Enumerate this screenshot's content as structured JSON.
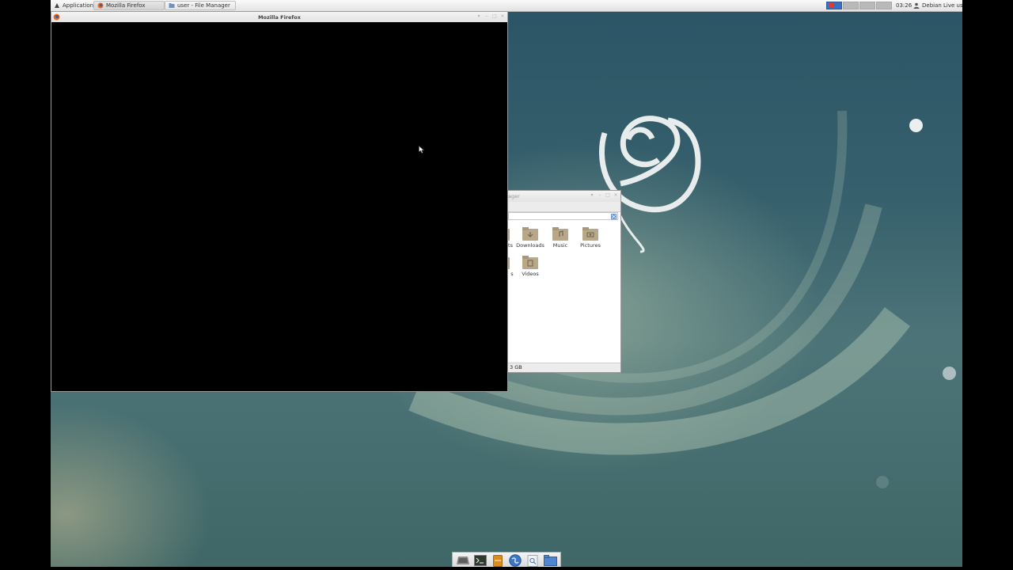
{
  "top_panel": {
    "applications_label": "Applications",
    "tasks": [
      {
        "label": "Mozilla Firefox",
        "icon": "firefox-icon"
      },
      {
        "label": "user - File Manager",
        "icon": "folder-icon"
      }
    ],
    "clock": "03:26",
    "user_label": "Debian Live user"
  },
  "firefox_window": {
    "title": "Mozilla Firefox"
  },
  "file_manager": {
    "title_partial": "ager",
    "items": [
      {
        "label": "ts",
        "partial": true
      },
      {
        "label": "Downloads",
        "icon": "download-folder-icon"
      },
      {
        "label": "Music",
        "icon": "music-folder-icon"
      },
      {
        "label": "Pictures",
        "icon": "pictures-folder-icon"
      },
      {
        "label": "s",
        "partial": true
      },
      {
        "label": "Videos",
        "icon": "videos-folder-icon"
      }
    ],
    "status_partial": "3 GB"
  },
  "dock": {
    "items": [
      "show-desktop-icon",
      "terminal-icon",
      "file-manager-icon",
      "web-browser-icon",
      "app-finder-icon",
      "folder-icon"
    ]
  },
  "colors": {
    "panel": "#e6e6e6",
    "desktop": "#3a6570",
    "folder": "#b8a888"
  }
}
